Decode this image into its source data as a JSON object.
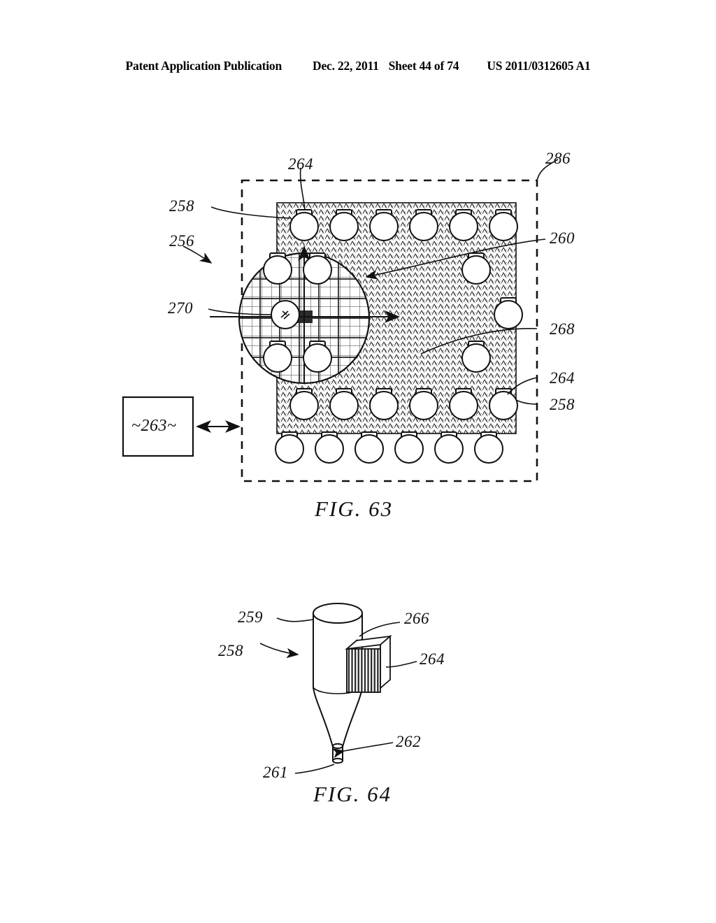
{
  "header": {
    "publication": "Patent Application Publication",
    "date": "Dec. 22, 2011",
    "sheet": "Sheet 44 of 74",
    "number": "US 2011/0312605 A1"
  },
  "figures": [
    {
      "id": "fig63",
      "caption": "FIG. 63",
      "description": "Plan view of a nozzle array chip with dashed boundary, hatched substrate, ring of circular nozzles, central grid region and an external control block",
      "labels": [
        {
          "key": "l264_top",
          "text": "264"
        },
        {
          "key": "l286",
          "text": "286"
        },
        {
          "key": "l258_left",
          "text": "258"
        },
        {
          "key": "l256",
          "text": "256"
        },
        {
          "key": "l260",
          "text": "260"
        },
        {
          "key": "l270",
          "text": "270"
        },
        {
          "key": "l268",
          "text": "268"
        },
        {
          "key": "l264_right",
          "text": "264"
        },
        {
          "key": "l258_right",
          "text": "258"
        },
        {
          "key": "block263",
          "text": "~263~"
        }
      ]
    },
    {
      "id": "fig64",
      "caption": "FIG. 64",
      "description": "Perspective view of a single nozzle: cylindrical body tapering to a conical tip with a ribbed heater element on its side",
      "labels": [
        {
          "key": "l259",
          "text": "259"
        },
        {
          "key": "l266",
          "text": "266"
        },
        {
          "key": "l258",
          "text": "258"
        },
        {
          "key": "l264",
          "text": "264"
        },
        {
          "key": "l262",
          "text": "262"
        },
        {
          "key": "l261",
          "text": "261"
        }
      ]
    }
  ],
  "colors": {
    "ink": "#111111",
    "paper": "#ffffff",
    "hatch": "#2a2a2a",
    "grid": "#333333"
  }
}
